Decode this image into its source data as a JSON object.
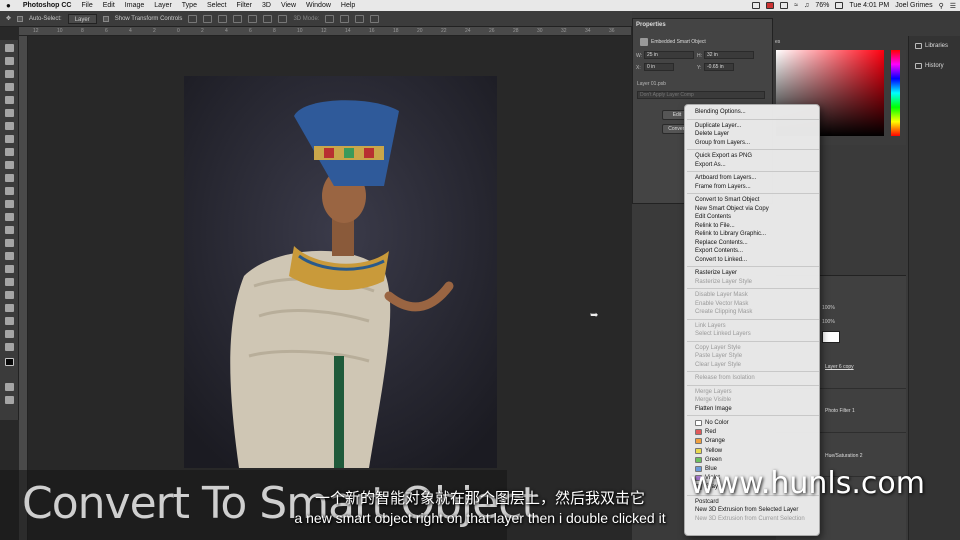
{
  "menubar": {
    "app_name": "Photoshop CC",
    "menus": [
      "File",
      "Edit",
      "Image",
      "Layer",
      "Type",
      "Select",
      "Filter",
      "3D",
      "View",
      "Window",
      "Help"
    ],
    "battery": "76%",
    "clock": "Tue 4:01 PM",
    "user": "Joel Grimes"
  },
  "options_bar": {
    "auto_select_label": "Auto-Select:",
    "auto_select_value": "Layer",
    "show_transform_label": "Show Transform Controls",
    "mode_3d_label": "3D Mode:"
  },
  "ruler_ticks": [
    "12",
    "10",
    "8",
    "6",
    "4",
    "2",
    "0",
    "2",
    "4",
    "6",
    "8",
    "10",
    "12",
    "14",
    "16",
    "18",
    "20",
    "22",
    "24",
    "26",
    "28",
    "30",
    "32",
    "34",
    "36",
    "38"
  ],
  "properties": {
    "title": "Properties",
    "object_type": "Embedded Smart Object",
    "w_label": "W:",
    "w_value": "25 in",
    "h_label": "H:",
    "h_value": "32 in",
    "x_label": "X:",
    "x_value": "0 in",
    "y_label": "Y:",
    "y_value": "-0.65 in",
    "file": "Layer 01.psb",
    "layer_comp_placeholder": "Don't Apply Layer Comp",
    "edit_button": "Edit",
    "convert_button": "Convert"
  },
  "color_panel": {
    "tab_suffix": "es"
  },
  "side_dock": {
    "libraries": "Libraries",
    "history": "History"
  },
  "layers": {
    "opacity": "100%",
    "fill": "100%",
    "rows": [
      "Layer 6 copy",
      "Photo Filter 1",
      "Hue/Saturation 2"
    ]
  },
  "context_menu": {
    "groups": [
      [
        {
          "label": "Blending Options...",
          "enabled": true
        }
      ],
      [
        {
          "label": "Duplicate Layer...",
          "enabled": true
        },
        {
          "label": "Delete Layer",
          "enabled": true
        },
        {
          "label": "Group from Layers...",
          "enabled": true
        }
      ],
      [
        {
          "label": "Quick Export as PNG",
          "enabled": true
        },
        {
          "label": "Export As...",
          "enabled": true
        }
      ],
      [
        {
          "label": "Artboard from Layers...",
          "enabled": true
        },
        {
          "label": "Frame from Layers...",
          "enabled": true
        }
      ],
      [
        {
          "label": "Convert to Smart Object",
          "enabled": true
        },
        {
          "label": "New Smart Object via Copy",
          "enabled": true
        },
        {
          "label": "Edit Contents",
          "enabled": true
        },
        {
          "label": "Relink to File...",
          "enabled": true
        },
        {
          "label": "Relink to Library Graphic...",
          "enabled": true
        },
        {
          "label": "Replace Contents...",
          "enabled": true
        },
        {
          "label": "Export Contents...",
          "enabled": true
        },
        {
          "label": "Convert to Linked...",
          "enabled": true
        }
      ],
      [
        {
          "label": "Rasterize Layer",
          "enabled": true
        },
        {
          "label": "Rasterize Layer Style",
          "enabled": false
        }
      ],
      [
        {
          "label": "Disable Layer Mask",
          "enabled": false
        },
        {
          "label": "Enable Vector Mask",
          "enabled": false
        },
        {
          "label": "Create Clipping Mask",
          "enabled": false
        }
      ],
      [
        {
          "label": "Link Layers",
          "enabled": false
        },
        {
          "label": "Select Linked Layers",
          "enabled": false
        }
      ],
      [
        {
          "label": "Copy Layer Style",
          "enabled": false
        },
        {
          "label": "Paste Layer Style",
          "enabled": false
        },
        {
          "label": "Clear Layer Style",
          "enabled": false
        }
      ],
      [
        {
          "label": "Release from Isolation",
          "enabled": false
        }
      ],
      [
        {
          "label": "Merge Layers",
          "enabled": false
        },
        {
          "label": "Merge Visible",
          "enabled": false
        },
        {
          "label": "Flatten Image",
          "enabled": true
        }
      ]
    ],
    "colors": [
      {
        "label": "No Color",
        "color": "#ffffff"
      },
      {
        "label": "Red",
        "color": "#e05a5a"
      },
      {
        "label": "Orange",
        "color": "#f0a040"
      },
      {
        "label": "Yellow",
        "color": "#e8d850"
      },
      {
        "label": "Green",
        "color": "#6cc060"
      },
      {
        "label": "Blue",
        "color": "#6a9ad8"
      },
      {
        "label": "Violet",
        "color": "#a87ad0"
      },
      {
        "label": "Gray",
        "color": "#a0a0a0"
      }
    ],
    "bottom": [
      {
        "label": "Postcard",
        "enabled": true
      },
      {
        "label": "New 3D Extrusion from Selected Layer",
        "enabled": true
      },
      {
        "label": "New 3D Extrusion from Current Selection",
        "enabled": false
      }
    ]
  },
  "overlay": {
    "big_title": "Convert To Smart Object",
    "subtitle_cn": "一个新的智能对象就在那个图层上，然后我双击它",
    "subtitle_en": "a new smart object right on that layer then i double clicked it",
    "watermark": "www.hunls.com"
  },
  "colors": {
    "menu_bg": "#ececec",
    "app_bg": "#282828",
    "panel_bg": "#3a3a3a"
  }
}
